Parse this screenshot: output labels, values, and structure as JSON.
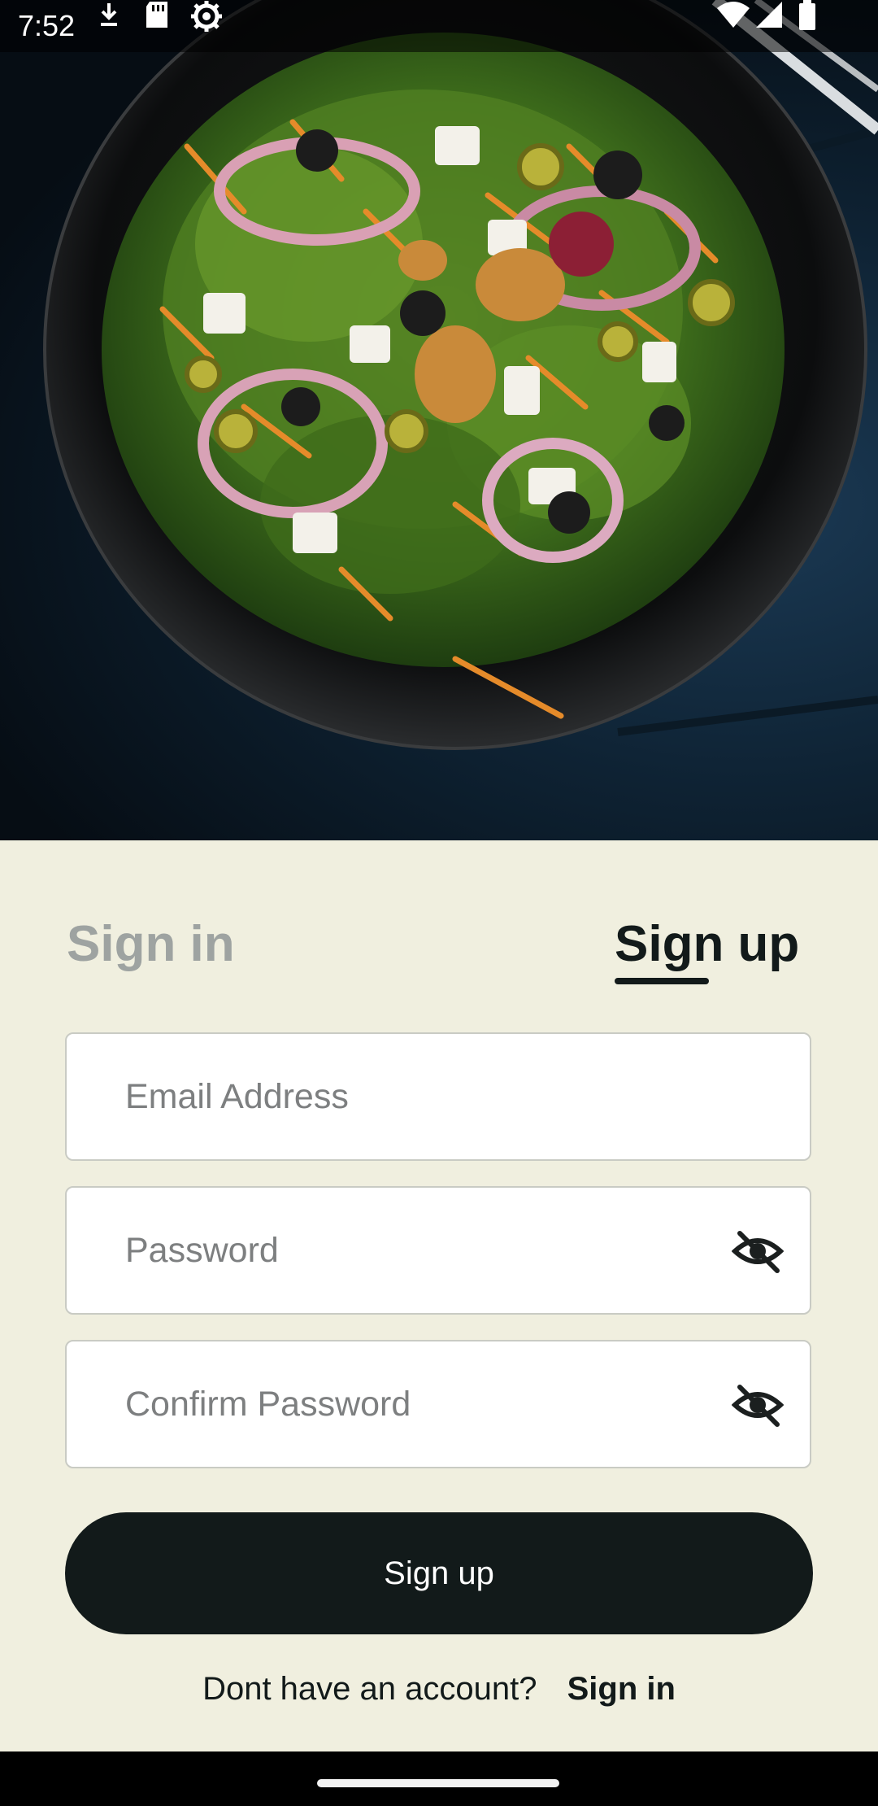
{
  "status_bar": {
    "time": "7:52",
    "icons": [
      "download-indicator-icon",
      "sd-card-icon",
      "settings-gear-icon",
      "wifi-icon",
      "cell-signal-icon",
      "battery-icon"
    ]
  },
  "hero": {
    "image": "salad-bowl-photo"
  },
  "tabs": {
    "sign_in": "Sign in",
    "sign_up": "Sign up",
    "active": "sign_up"
  },
  "form": {
    "email_placeholder": "Email Address",
    "email_value": "",
    "password_placeholder": "Password",
    "password_value": "",
    "confirm_placeholder": "Confirm Password",
    "confirm_value": "",
    "visibility_icon": "eye-off-icon"
  },
  "signup_button_label": "Sign up",
  "footer": {
    "prompt": "Dont have an account?",
    "link": "Sign in"
  },
  "colors": {
    "panel_bg": "#f0efdf",
    "primary": "#121a1a",
    "inactive_tab": "#9ea3a1",
    "field_bg": "#ffffff",
    "field_border": "#c9cbc4"
  }
}
